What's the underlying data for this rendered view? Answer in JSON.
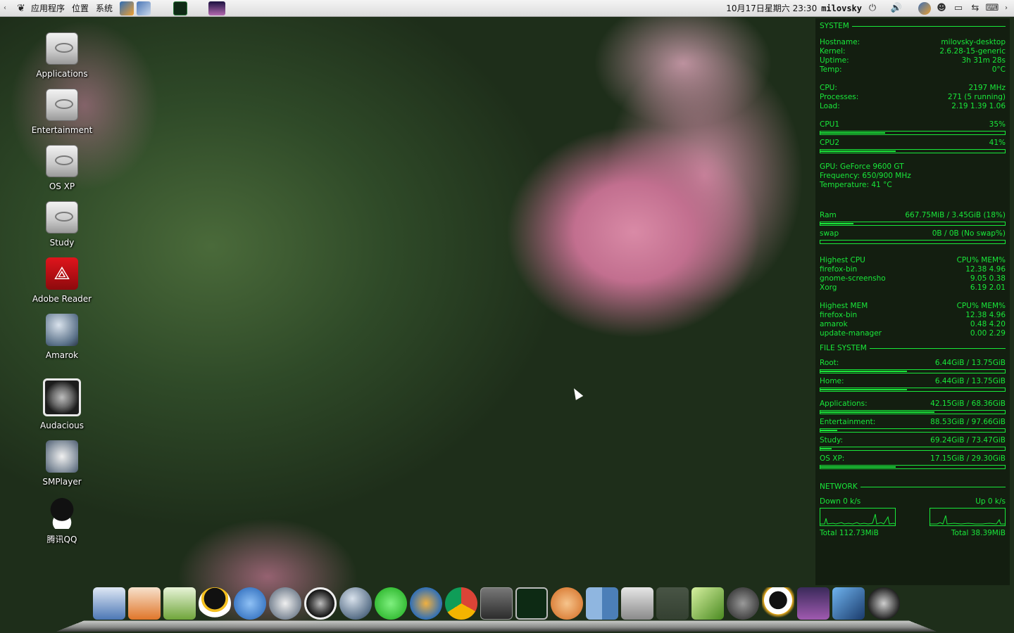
{
  "top_panel": {
    "menus": [
      "应用程序",
      "位置",
      "系统"
    ],
    "clock": "10月17日星期六 23:30",
    "username": "milovsky"
  },
  "desktop_icons": [
    {
      "label": "Applications",
      "icon": "drive-icon"
    },
    {
      "label": "Entertainment",
      "icon": "drive-icon"
    },
    {
      "label": "OS XP",
      "icon": "drive-icon"
    },
    {
      "label": "Study",
      "icon": "drive-icon"
    },
    {
      "label": "Adobe Reader",
      "icon": "adobe-reader-icon"
    },
    {
      "label": "Amarok",
      "icon": "amarok-icon"
    },
    {
      "label": "Audacious",
      "icon": "audacious-icon"
    },
    {
      "label": "SMPlayer",
      "icon": "smplayer-icon"
    },
    {
      "label": "腾讯QQ",
      "icon": "qq-icon"
    }
  ],
  "conky": {
    "accent_color": "#19e83a",
    "system": {
      "title": "SYSTEM",
      "hostname_label": "Hostname:",
      "hostname": "milovsky-desktop",
      "kernel_label": "Kernel:",
      "kernel": "2.6.28-15-generic",
      "uptime_label": "Uptime:",
      "uptime": "3h 31m 28s",
      "temp_label": "Temp:",
      "temp": "0°C",
      "cpu_label": "CPU:",
      "cpu": "2197 MHz",
      "processes_label": "Processes:",
      "processes": "271 (5 running)",
      "load_label": "Load:",
      "load": "2.19 1.39 1.06",
      "cpu1_label": "CPU1",
      "cpu1": "35%",
      "cpu1_pct": 35,
      "cpu2_label": "CPU2",
      "cpu2": "41%",
      "cpu2_pct": 41,
      "gpu": "GPU: GeForce 9600 GT",
      "gpu_freq": "Frequency: 650/900 MHz",
      "gpu_temp": "Temperature: 41 °C",
      "ram_label": "Ram",
      "ram": "667.75MiB / 3.45GiB (18%)",
      "ram_pct": 18,
      "swap_label": "swap",
      "swap": "0B / 0B (No swap%)",
      "swap_pct": 0
    },
    "highest_cpu": {
      "title": "Highest CPU",
      "cols": "CPU% MEM%",
      "rows": [
        {
          "name": "firefox-bin",
          "vals": "12.38 4.96"
        },
        {
          "name": "gnome-screensho",
          "vals": "9.05 0.38"
        },
        {
          "name": "Xorg",
          "vals": "6.19 2.01"
        }
      ]
    },
    "highest_mem": {
      "title": "Highest MEM",
      "cols": "CPU% MEM%",
      "rows": [
        {
          "name": "firefox-bin",
          "vals": "12.38 4.96"
        },
        {
          "name": "amarok",
          "vals": "0.48 4.20"
        },
        {
          "name": "update-manager",
          "vals": "0.00 2.29"
        }
      ]
    },
    "filesystem": {
      "title": "FILE SYSTEM",
      "items": [
        {
          "label": "Root:",
          "value": "6.44GiB / 13.75GiB",
          "pct": 47
        },
        {
          "label": "Home:",
          "value": "6.44GiB / 13.75GiB",
          "pct": 47
        },
        {
          "label": "Applications:",
          "value": "42.15GiB / 68.36GiB",
          "pct": 62
        },
        {
          "label": "Entertainment:",
          "value": "88.53GiB / 97.66GiB",
          "pct": 9
        },
        {
          "label": "Study:",
          "value": "69.24GiB / 73.47GiB",
          "pct": 6
        },
        {
          "label": "OS XP:",
          "value": "17.15GiB / 29.30GiB",
          "pct": 41
        }
      ]
    },
    "network": {
      "title": "NETWORK",
      "down": "Down 0 k/s",
      "up": "Up 0 k/s",
      "total_down": "Total 112.73MiB",
      "total_up": "Total 38.39MiB"
    }
  },
  "dock": [
    "writer-icon",
    "impress-icon",
    "calc-icon",
    "qq-icon",
    "media-player-icon",
    "smplayer-icon",
    "audacious-icon",
    "amarok-icon",
    "download-icon",
    "thunderbird-icon",
    "chrome-icon",
    "terminal-icon",
    "system-monitor-icon",
    "update-icon",
    "finder-icon",
    "screenshot-icon",
    "usa-icon",
    "wallpaper-icon",
    "gimp-icon",
    "tux-icon",
    "photo-icon",
    "pointer-icon",
    "power-icon"
  ]
}
